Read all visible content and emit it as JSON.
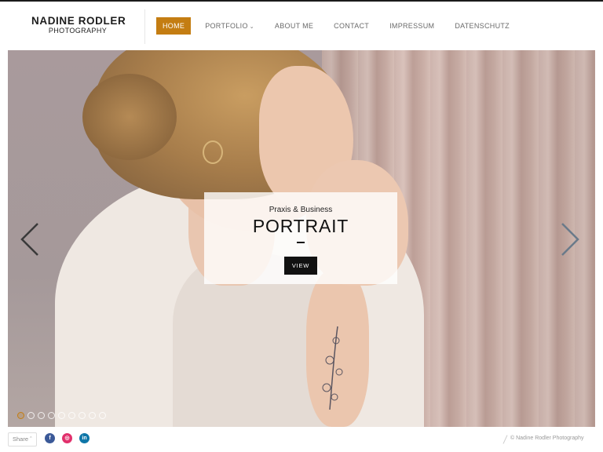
{
  "logo": {
    "name": "NADINE RODLER",
    "subtitle": "PHOTOGRAPHY"
  },
  "nav": {
    "items": [
      {
        "label": "HOME",
        "active": true
      },
      {
        "label": "PORTFOLIO",
        "has_dropdown": true
      },
      {
        "label": "ABOUT ME"
      },
      {
        "label": "CONTACT"
      },
      {
        "label": "IMPRESSUM"
      },
      {
        "label": "DATENSCHUTZ"
      }
    ]
  },
  "slider": {
    "caption_subtitle": "Praxis & Business",
    "caption_title": "PORTRAIT",
    "button_label": "VIEW",
    "active_slide": 1,
    "slide_count": 9
  },
  "footer": {
    "share_label": "Share",
    "social": [
      "f",
      "◎",
      "in"
    ],
    "copyright": "© Nadine Rodler Photography"
  },
  "colors": {
    "accent": "#c47d12",
    "header_line": "#1a1a1a"
  }
}
